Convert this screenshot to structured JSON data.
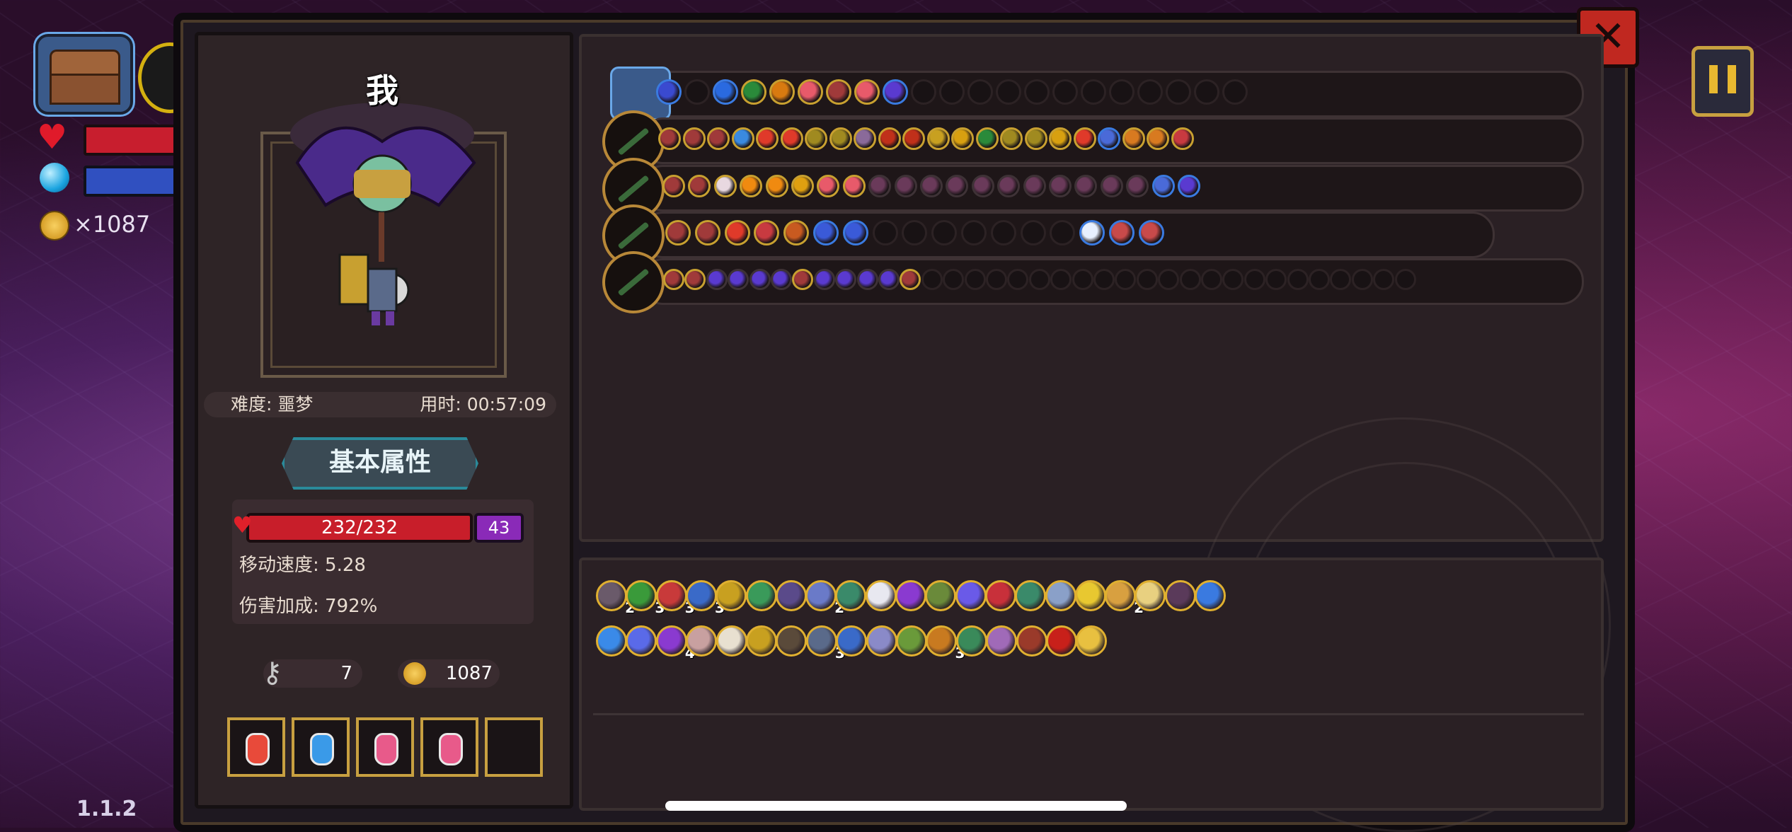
{
  "hud": {
    "coins": "×1087",
    "version": "1.1.2"
  },
  "character": {
    "name": "我",
    "difficulty": "难度: 噩梦",
    "time": "用时: 00:57:09",
    "section_title": "基本属性",
    "hp": "232/232",
    "armor": "43",
    "move_speed": "移动速度: 5.28",
    "damage_bonus": "伤害加成: 792%",
    "keys": "7",
    "gold": "1087"
  },
  "colors": {
    "accent_gold": "#c8a040",
    "hp_red": "#c81e2a",
    "mana_blue": "#3050c0",
    "armor_purple": "#8a2ab8",
    "teal": "#2a8a9a"
  },
  "icons": [
    "chest-icon",
    "close-icon",
    "pause-icon",
    "heart-icon",
    "mana-orb-icon",
    "coin-icon",
    "key-icon",
    "potion-icon",
    "weapon-icon"
  ],
  "potions": [
    "red",
    "blue",
    "pink",
    "pink",
    "empty"
  ],
  "weapon_rows": [
    {
      "slots": [
        "spiral",
        "empty",
        "vial",
        "rainbow",
        "burst",
        "flower",
        "heart",
        "flower",
        "wing",
        "empty",
        "empty",
        "empty",
        "empty",
        "empty",
        "empty",
        "empty",
        "empty",
        "empty",
        "empty",
        "empty",
        "empty"
      ]
    },
    {
      "slots": [
        "heart",
        "heart",
        "heart",
        "arrow",
        "bomb",
        "bomb",
        "rune",
        "rune",
        "scroll",
        "eye",
        "eye",
        "chest",
        "up",
        "rainbow",
        "rune",
        "rune",
        "up",
        "bomb",
        "star",
        "claw",
        "claw",
        "tri"
      ]
    },
    {
      "slots": [
        "heart",
        "heart",
        "skull",
        "sun",
        "sun",
        "dash",
        "flower",
        "flower",
        "spike",
        "spike",
        "spike",
        "spike",
        "spike",
        "spike",
        "spike",
        "spike",
        "spike",
        "spike",
        "spike",
        "star",
        "wing"
      ]
    },
    {
      "slots": [
        "heart",
        "heart",
        "bomb",
        "tri",
        "bow",
        "gem",
        "gem",
        "empty",
        "empty",
        "empty",
        "empty",
        "empty",
        "empty",
        "empty",
        "shield",
        "rock",
        "rock"
      ]
    },
    {
      "slots": [
        "heart",
        "heart",
        "wing",
        "wing",
        "wing",
        "wing",
        "heart",
        "wing",
        "wing",
        "wing",
        "wing",
        "heart",
        "empty",
        "empty",
        "empty",
        "empty",
        "empty",
        "empty",
        "empty",
        "empty",
        "empty",
        "empty",
        "empty",
        "empty",
        "empty",
        "empty",
        "empty",
        "empty",
        "empty",
        "empty",
        "empty",
        "empty",
        "empty",
        "empty",
        "empty"
      ]
    }
  ],
  "item_counts": {
    "row1": [
      "2",
      "3",
      "3",
      "3",
      "",
      "",
      "",
      "2",
      "",
      "",
      "",
      "",
      "",
      "",
      "",
      "",
      "",
      "2",
      "",
      "",
      ""
    ],
    "row2": [
      "",
      "",
      "4",
      "",
      "",
      "",
      "",
      "3",
      "",
      "",
      "",
      "3",
      "",
      "",
      "",
      "",
      ""
    ]
  }
}
